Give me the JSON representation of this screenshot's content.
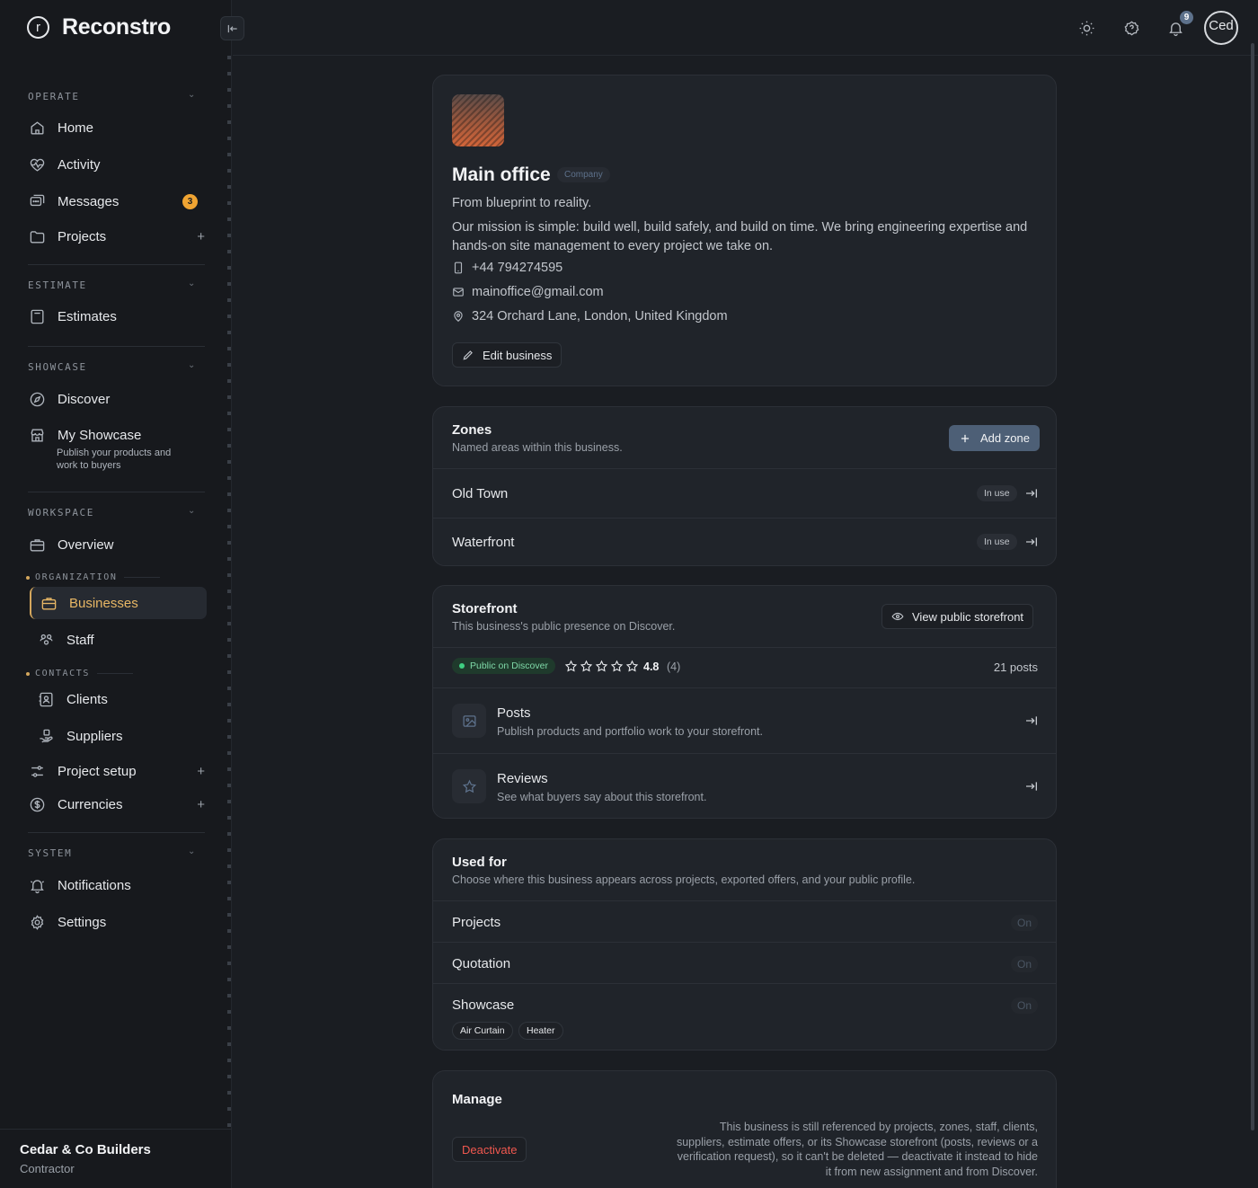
{
  "brand": {
    "logo_letter": "r",
    "name": "Reconstro"
  },
  "sidebar": {
    "sections": {
      "operate": "OPERATE",
      "estimate": "ESTIMATE",
      "showcase": "SHOWCASE",
      "workspace": "WORKSPACE",
      "system": "SYSTEM"
    },
    "groups": {
      "organization": "ORGANIZATION",
      "contacts": "CONTACTS"
    },
    "items": {
      "home": "Home",
      "activity": "Activity",
      "messages": "Messages",
      "messages_badge": "3",
      "projects": "Projects",
      "estimates": "Estimates",
      "discover": "Discover",
      "my_showcase": "My Showcase",
      "my_showcase_desc": "Publish your products and work to buyers",
      "overview": "Overview",
      "businesses": "Businesses",
      "staff": "Staff",
      "clients": "Clients",
      "suppliers": "Suppliers",
      "project_setup": "Project setup",
      "currencies": "Currencies",
      "notifications": "Notifications",
      "settings": "Settings"
    },
    "plus": "+",
    "chevron": "⌄",
    "footer": {
      "company": "Cedar & Co Builders",
      "role": "Contractor"
    }
  },
  "topbar": {
    "notifications_count": "9",
    "avatar_text": "Ced"
  },
  "business": {
    "name": "Main office",
    "type_badge": "Company",
    "tagline": "From blueprint to reality.",
    "mission": "Our mission is simple: build well, build safely, and build on time. We bring engineering expertise and hands-on site management to every project we take on.",
    "phone": "+44 794274595",
    "email": "mainoffice@gmail.com",
    "address": "324 Orchard Lane, London, United Kingdom",
    "edit_label": "Edit business"
  },
  "zones": {
    "title": "Zones",
    "subtitle": "Named areas within this business.",
    "add_label": "Add zone",
    "items": [
      {
        "name": "Old Town",
        "status": "In use"
      },
      {
        "name": "Waterfront",
        "status": "In use"
      }
    ]
  },
  "storefront": {
    "title": "Storefront",
    "subtitle": "This business's public presence on Discover.",
    "view_label": "View public storefront",
    "public_badge": "Public on Discover",
    "rating": 4.8,
    "rating_text": "4.8",
    "rating_count": "(4)",
    "posts_count": "21 posts",
    "posts": {
      "title": "Posts",
      "subtitle": "Publish products and portfolio work to your storefront."
    },
    "reviews": {
      "title": "Reviews",
      "subtitle": "See what buyers say about this storefront."
    }
  },
  "used_for": {
    "title": "Used for",
    "subtitle": "Choose where this business appears across projects, exported offers, and your public profile.",
    "items": [
      {
        "label": "Projects",
        "state": "On"
      },
      {
        "label": "Quotation",
        "state": "On"
      },
      {
        "label": "Showcase",
        "state": "On"
      }
    ],
    "showcase_tags": [
      "Air Curtain",
      "Heater"
    ]
  },
  "manage": {
    "title": "Manage",
    "deactivate_label": "Deactivate",
    "note": "This business is still referenced by projects, zones, staff, clients, suppliers, estimate offers, or its Showcase storefront (posts, reviews or a verification request), so it can't be deleted — deactivate it instead to hide it from new assignment and from Discover."
  }
}
